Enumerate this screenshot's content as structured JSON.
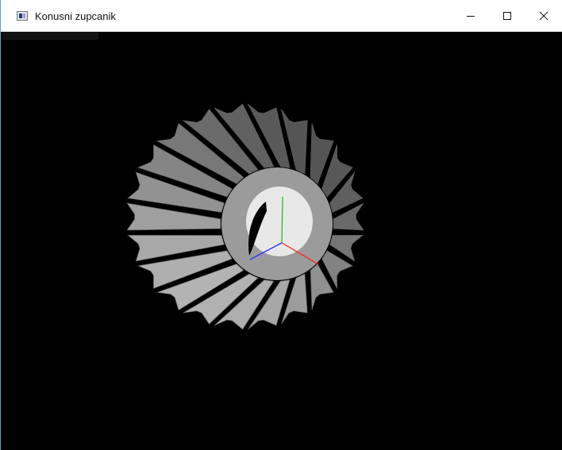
{
  "window": {
    "title": "Konusni zupcanik",
    "icon": "app-window-icon",
    "controls": {
      "minimize_icon": "minimize-icon",
      "maximize_icon": "maximize-icon",
      "close_icon": "close-icon"
    }
  },
  "scene": {
    "object": "bevel-gear",
    "background_color": "#000000",
    "gear_color": "#a9a9a9",
    "hub_color": "#e8e8e8",
    "axis_x_color": "#ff2020",
    "axis_y_color": "#20c020",
    "axis_z_color": "#3030ff",
    "tooth_count": 22
  }
}
